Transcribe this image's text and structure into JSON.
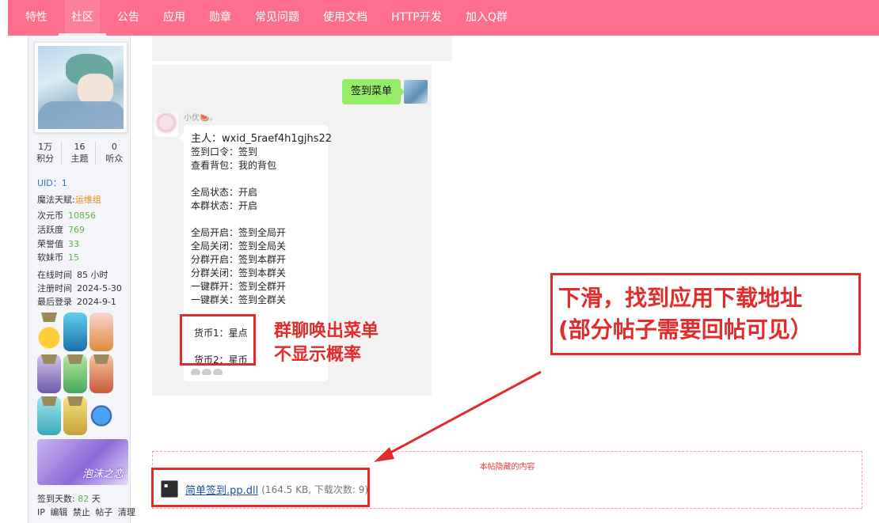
{
  "nav": {
    "items": [
      "特性",
      "社区",
      "公告",
      "应用",
      "勋章",
      "常见问题",
      "使用文档",
      "HTTP开发",
      "加入Q群"
    ],
    "active_index": 1,
    "bg_color": "#fd6f8d"
  },
  "profile": {
    "stats": [
      {
        "num": "1万",
        "label": "积分"
      },
      {
        "num": "16",
        "label": "主题"
      },
      {
        "num": "0",
        "label": "听众"
      }
    ],
    "uid_label": "UID：",
    "uid_value": "1",
    "talent_label": "魔法天赋:",
    "talent_value": "运维组",
    "currency_label": "次元币",
    "currency_value": "10856",
    "activity_label": "活跃度",
    "activity_value": "769",
    "honor_label": "荣誉值",
    "honor_value": "33",
    "soft_label": "软妹币",
    "soft_value": "15",
    "online_label": "在线时间",
    "online_value": "85 小时",
    "register_label": "注册时间",
    "register_value": "2024-5-30",
    "lastlogin_label": "最后登录",
    "lastlogin_value": "2024-9-1",
    "banner_text": "泡沫之恋",
    "signin_label": "签到天数:",
    "signin_value": "82",
    "signin_unit": "天",
    "actions": [
      "IP",
      "编辑",
      "禁止",
      "帖子",
      "清理"
    ]
  },
  "chat": {
    "right_bubble": "签到菜单",
    "sender_name": "小优🍉。",
    "lines": [
      "主人：wxid_5raef4h1gjhs22",
      "签到口令：签到",
      "查看背包：我的背包",
      "",
      "全局状态：开启",
      "本群状态：开启",
      "",
      "全局开启：签到全局开",
      "全局关闭：签到全局关",
      "分群开启：签到本群开",
      "分群关闭：签到本群关",
      "一键群开：签到全群开",
      "一键群关：签到全群关",
      "",
      "货币1：星点",
      "",
      "货币2：星币"
    ]
  },
  "annotations": {
    "callout_menu_line1": "群聊唤出菜单",
    "callout_menu_line2": "不显示概率",
    "callout_download_line1": "下滑，找到应用下载地址",
    "callout_download_line2": "(部分帖子需要回帖可见）",
    "red_color": "#e22b2b"
  },
  "hidden_content": {
    "title": "本帖隐藏的内容",
    "file_name": "简单签到.pp.dll",
    "file_meta": "(164.5 KB, 下载次数: 9)"
  },
  "icons": {
    "file": "dll-file-icon"
  }
}
